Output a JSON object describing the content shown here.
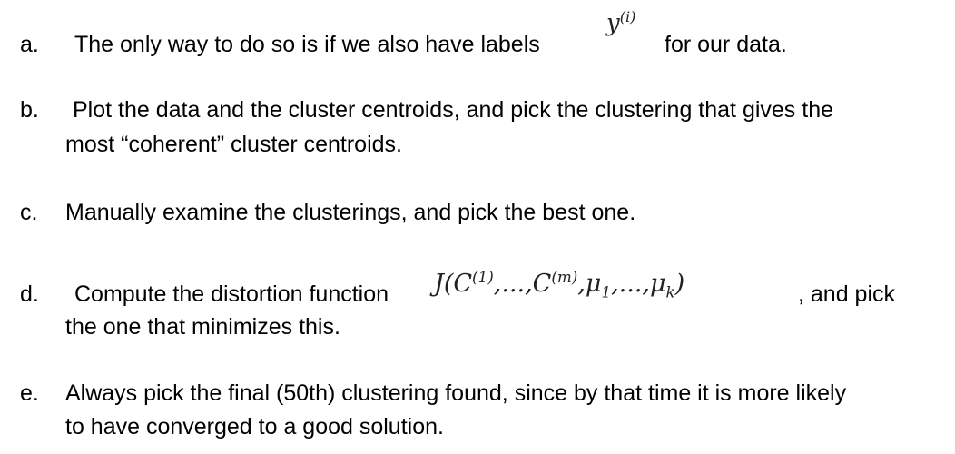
{
  "options": [
    {
      "letter": "a.",
      "line1_text": "The only way to do so is if we also have labels",
      "line1_after": "for our data.",
      "math": "y(i)"
    },
    {
      "letter": "b.",
      "line1_text": "Plot the data and the cluster centroids, and pick the clustering that gives the",
      "line2_text": "most “coherent” cluster centroids."
    },
    {
      "letter": "c.",
      "line1_text": "Manually examine the clusterings, and pick the best one."
    },
    {
      "letter": "d.",
      "line1_text": "Compute the distortion function",
      "line1_after": ", and pick",
      "line2_text": "the one that minimizes this.",
      "math": "J(C(1),...,C(m),μ1,...,μk)"
    },
    {
      "letter": "e.",
      "line1_text": "Always pick the final (50th) clustering found, since by that time it is more likely",
      "line2_text": "to have converged to a good solution."
    }
  ]
}
